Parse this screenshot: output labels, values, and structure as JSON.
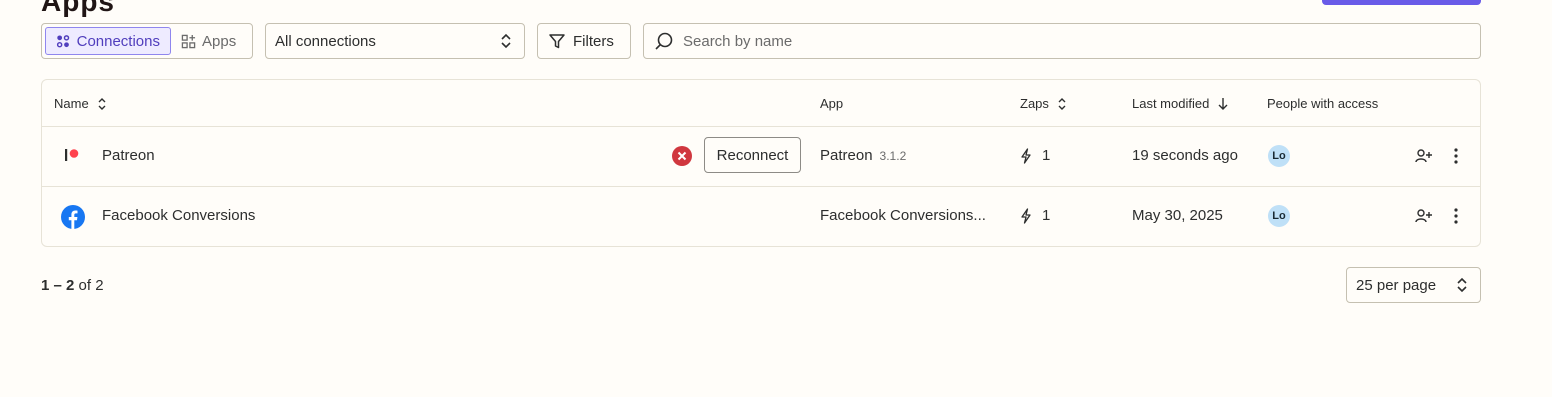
{
  "page": {
    "title": "Apps"
  },
  "toolbar": {
    "tabs": [
      {
        "label": "Connections",
        "active": true,
        "icon": "connections-icon"
      },
      {
        "label": "Apps",
        "active": false,
        "icon": "apps-grid-icon"
      }
    ],
    "connection_filter": "All connections",
    "filters_label": "Filters",
    "search_placeholder": "Search by name"
  },
  "table": {
    "headers": {
      "name": "Name",
      "app": "App",
      "zaps": "Zaps",
      "last_modified": "Last modified",
      "people": "People with access"
    },
    "rows": [
      {
        "name": "Patreon",
        "icon": "patreon-logo",
        "status": "error",
        "reconnect_label": "Reconnect",
        "app": "Patreon",
        "version": "3.1.2",
        "zaps": "1",
        "last_modified": "19 seconds ago",
        "avatar": "Lo"
      },
      {
        "name": "Facebook Conversions",
        "icon": "facebook-logo",
        "app": "Facebook Conversions...",
        "zaps": "1",
        "last_modified": "May 30, 2025",
        "avatar": "Lo"
      }
    ]
  },
  "pagination": {
    "range": "1 – 2",
    "of_label": "of 2",
    "per_page": "25 per page"
  },
  "colors": {
    "accent": "#695be8",
    "error": "#d0373f",
    "facebook": "#1877f2",
    "patreon": "#ff424d",
    "avatar_bg": "#bfe0f7"
  }
}
